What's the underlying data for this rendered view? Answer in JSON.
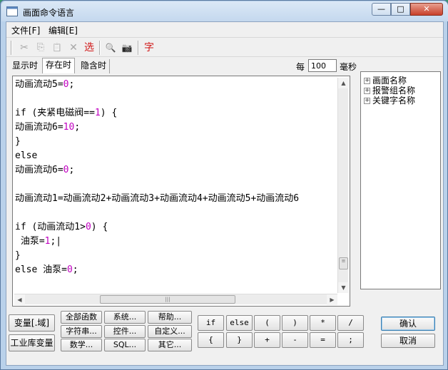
{
  "window": {
    "title": "画面命令语言",
    "minimize": "—",
    "maximize": "□",
    "close": "✕"
  },
  "menu": {
    "file": "文件[F]",
    "edit": "编辑[E]"
  },
  "toolbar": {
    "cut": "✂",
    "copy": "⎘",
    "paste": "📋",
    "delete": "✕",
    "select_label": "选",
    "find": "🔍",
    "replace": "📷",
    "font_label": "字"
  },
  "tabs": {
    "show": "显示时",
    "exist": "存在时",
    "hidden": "隐含时"
  },
  "interval": {
    "prefix": "每",
    "value": "100",
    "unit": "毫秒"
  },
  "editor": {
    "lines": [
      {
        "segments": [
          {
            "text": "动画流动5="
          },
          {
            "text": "0",
            "num": true
          },
          {
            "text": ";"
          }
        ]
      },
      {
        "segments": [
          {
            "text": ""
          }
        ]
      },
      {
        "segments": [
          {
            "text": "if (夹紧电磁阀=="
          },
          {
            "text": "1",
            "num": true
          },
          {
            "text": ") {"
          }
        ]
      },
      {
        "segments": [
          {
            "text": "动画流动6="
          },
          {
            "text": "10",
            "num": true
          },
          {
            "text": ";"
          }
        ]
      },
      {
        "segments": [
          {
            "text": "}"
          }
        ]
      },
      {
        "segments": [
          {
            "text": "else"
          }
        ]
      },
      {
        "segments": [
          {
            "text": "动画流动6="
          },
          {
            "text": "0",
            "num": true
          },
          {
            "text": ";"
          }
        ]
      },
      {
        "segments": [
          {
            "text": ""
          }
        ]
      },
      {
        "segments": [
          {
            "text": "动画流动1=动画流动2+动画流动3+动画流动4+动画流动5+动画流动6"
          }
        ]
      },
      {
        "segments": [
          {
            "text": ""
          }
        ]
      },
      {
        "segments": [
          {
            "text": "if (动画流动1>"
          },
          {
            "text": "0",
            "num": true
          },
          {
            "text": ") {"
          }
        ]
      },
      {
        "segments": [
          {
            "text": " 油泵="
          },
          {
            "text": "1",
            "num": true
          },
          {
            "text": ";|"
          }
        ]
      },
      {
        "segments": [
          {
            "text": "}"
          }
        ]
      },
      {
        "segments": [
          {
            "text": "else 油泵="
          },
          {
            "text": "0",
            "num": true
          },
          {
            "text": ";"
          }
        ]
      }
    ],
    "vscroll_position": 0.93,
    "hscroll_position": 0.45
  },
  "tree": {
    "items": [
      {
        "expander": "+",
        "label": "画面名称"
      },
      {
        "expander": "+",
        "label": "报警组名称"
      },
      {
        "expander": "+",
        "label": "关键字名称"
      }
    ]
  },
  "buttons": {
    "var_field": "变量[.域]",
    "industrial_var": "工业库变量",
    "all_functions": "全部函数",
    "system": "系统...",
    "help": "帮助...",
    "string": "字符串...",
    "control": "控件...",
    "custom": "自定义...",
    "math": "数学...",
    "sql": "SQL...",
    "other": "其它...",
    "ops_row1": [
      "if",
      "else",
      "(",
      ")",
      "*",
      "/"
    ],
    "ops_row2": [
      "{",
      "}",
      "+",
      "-",
      "=",
      ";"
    ],
    "ok": "确认",
    "cancel": "取消"
  }
}
